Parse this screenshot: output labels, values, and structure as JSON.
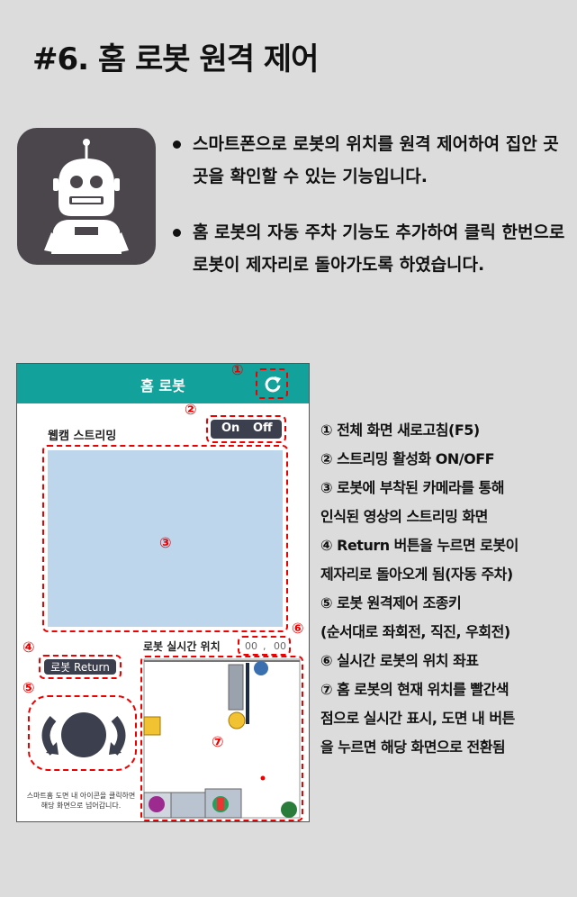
{
  "page_title": "#6. 홈 로봇 원격 제어",
  "app_icon": "robot-icon",
  "description": [
    "스마트폰으로 로봇의 위치를 원격 제어하여 집안 곳곳을 확인할 수 있는 기능입니다.",
    "홈 로봇의 자동 주차 기능도 추가하여 클릭 한번으로 로봇이 제자리로 돌아가도록 하였습니다."
  ],
  "phone": {
    "header_title": "홈 로봇",
    "header_color": "#12a19b",
    "refresh_icon": "refresh-icon",
    "webcam_label": "웹캠 스트리밍",
    "toggle_on": "On",
    "toggle_off": "Off",
    "position_label": "로봇 실시간 위치",
    "coord_x": "00",
    "coord_sep": ",",
    "coord_y": "00",
    "return_button": "로봇 Return",
    "help_line1": "스마트홈 도면 내 아이콘을 클릭하면",
    "help_line2": "해당 화면으로 넘어갑니다.",
    "markers": [
      "①",
      "②",
      "③",
      "④",
      "⑤",
      "⑥",
      "⑦"
    ]
  },
  "legend": [
    "① 전체 화면 새로고침(F5)",
    "② 스트리밍 활성화 ON/OFF",
    "③ 로봇에 부착된 카메라를 통해",
    "인식된 영상의 스트리밍 화면",
    "④ Return 버튼을 누르면 로봇이",
    "제자리로 돌아오게 됨(자동 주차)",
    "⑤ 로봇 원격제어 조종키",
    "(순서대로 좌회전, 직진, 우회전)",
    "⑥ 실시간 로봇의 위치 좌표",
    "⑦ 홈 로봇의 현재 위치를 빨간색",
    "점으로 실시간 표시, 도면 내 버튼",
    "을 누르면 해당 화면으로 전환됨"
  ]
}
